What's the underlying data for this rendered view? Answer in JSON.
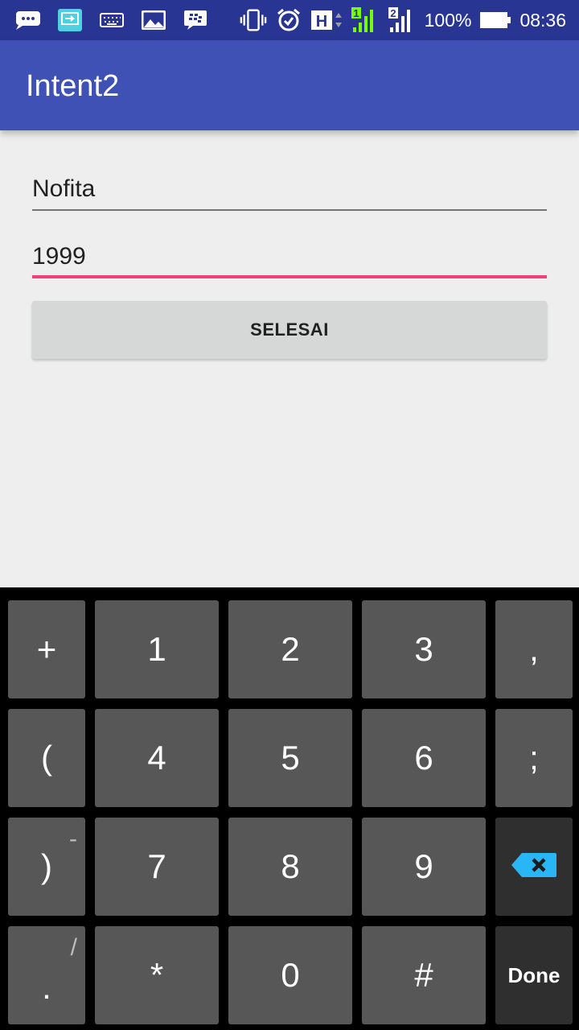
{
  "status_bar": {
    "battery": "100%",
    "time": "08:36",
    "network_h": "H",
    "sim1": "1",
    "sim2": "2"
  },
  "app_bar": {
    "title": "Intent2"
  },
  "form": {
    "name_value": "Nofita",
    "year_value": "1999",
    "submit_label": "SELESAI"
  },
  "keyboard": {
    "rows": [
      [
        {
          "main": "+",
          "sub": ""
        },
        {
          "main": "1"
        },
        {
          "main": "2"
        },
        {
          "main": "3"
        },
        {
          "main": ",",
          "sub": ""
        }
      ],
      [
        {
          "main": "(",
          "sub": ""
        },
        {
          "main": "4"
        },
        {
          "main": "5"
        },
        {
          "main": "6"
        },
        {
          "main": ";",
          "sub": ""
        }
      ],
      [
        {
          "main": ")",
          "sub": "-"
        },
        {
          "main": "7"
        },
        {
          "main": "8"
        },
        {
          "main": "9"
        },
        {
          "main": "backspace"
        }
      ],
      [
        {
          "main": ".",
          "sub": "/"
        },
        {
          "main": "*"
        },
        {
          "main": "0"
        },
        {
          "main": "#"
        },
        {
          "main": "Done"
        }
      ]
    ],
    "accent": "#29b6f6"
  }
}
